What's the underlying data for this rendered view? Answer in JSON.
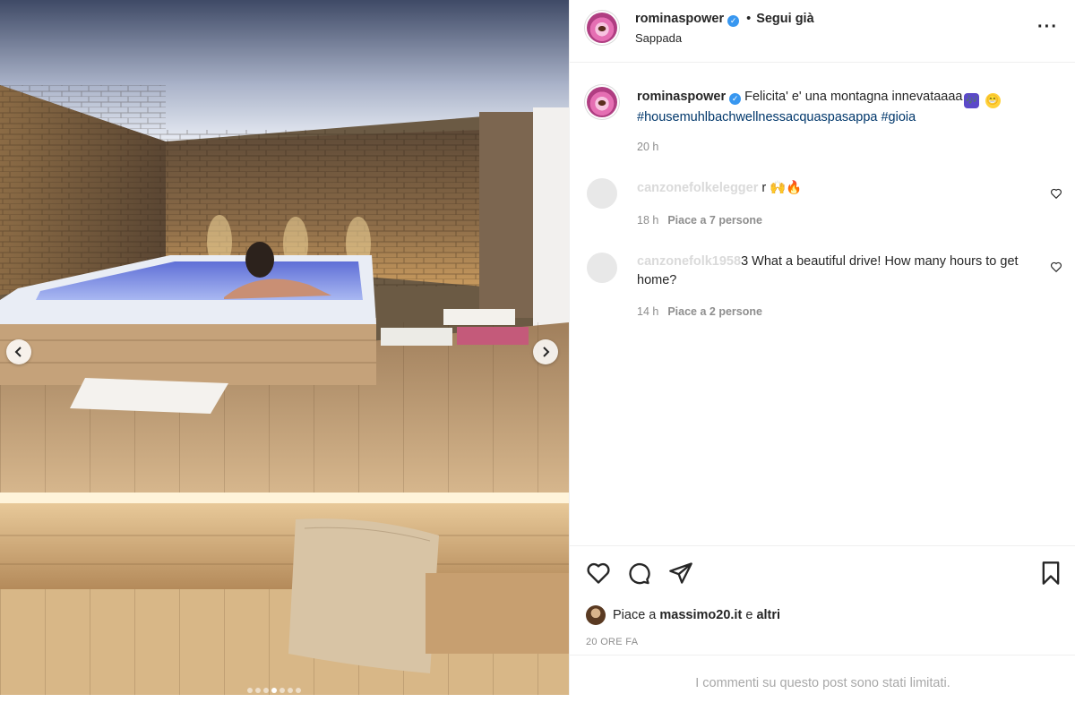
{
  "post": {
    "username": "rominaspower",
    "verified": true,
    "follow_status": "Segui già",
    "separator": "•",
    "location": "Sappada",
    "more_icon": "more-horizontal-icon"
  },
  "caption": {
    "username": "rominaspower",
    "text": "Felicita' e' una montagna innevataaaa",
    "emoji_1": "🎶",
    "emoji_2": "😁",
    "hashtag_1": "#housemuhlbachwellnessacquaspasappa",
    "hashtag_2": "#gioia",
    "time": "20 h"
  },
  "comments": [
    {
      "user": "canzonefolkelegger",
      "text_visible": "r 🙌🔥",
      "time": "18 h",
      "likes": "Piace a 7 persone"
    },
    {
      "user": "canzonefolk1958",
      "text_visible_line1": "3 What a beautiful drive! How many hours to get",
      "text_visible_line2": "home?",
      "time": "14 h",
      "likes": "Piace a 2 persone"
    }
  ],
  "likes_line": {
    "prefix": "Piace a",
    "user": "massimo20.it",
    "conj": "e",
    "others": "altri"
  },
  "posted_ago": "20 ORE FA",
  "comments_limited": "I commenti su questo post sono stati limitati.",
  "carousel": {
    "total_slides": 7,
    "active_index": 4
  },
  "colors": {
    "link": "#00376b",
    "verified": "#3897f0",
    "muted": "#8e8e8e"
  }
}
